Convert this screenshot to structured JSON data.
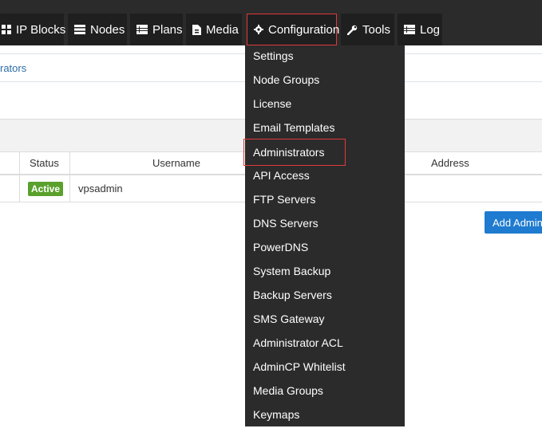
{
  "nav": {
    "tabs": [
      {
        "label": "IP Blocks",
        "icon": "grid-icon"
      },
      {
        "label": "Nodes",
        "icon": "server-icon"
      },
      {
        "label": "Plans",
        "icon": "list-icon"
      },
      {
        "label": "Media",
        "icon": "file-icon"
      },
      {
        "label": "Configuration",
        "icon": "gear-icon",
        "active": true
      },
      {
        "label": "Tools",
        "icon": "wrench-icon"
      },
      {
        "label": "Log",
        "icon": "list-icon"
      }
    ]
  },
  "breadcrumb": {
    "text": "rators"
  },
  "table": {
    "headers": {
      "status": "Status",
      "username": "Username",
      "address": "Address"
    },
    "rows": [
      {
        "status": "Active",
        "username": "vpsadmin"
      }
    ]
  },
  "add_button": {
    "label": "Add Admin"
  },
  "config_menu": {
    "items": [
      "Settings",
      "Node Groups",
      "License",
      "Email Templates",
      "Administrators",
      "API Access",
      "FTP Servers",
      "DNS Servers",
      "PowerDNS",
      "System Backup",
      "Backup Servers",
      "SMS Gateway",
      "Administrator ACL",
      "AdminCP Whitelist",
      "Media Groups",
      "Keymaps"
    ],
    "selected": "Administrators"
  },
  "colors": {
    "active_badge": "#5aa02c",
    "button_blue": "#1f7bcf",
    "highlight_red": "#e03a3a",
    "nav_dark": "#2b2b2b"
  }
}
